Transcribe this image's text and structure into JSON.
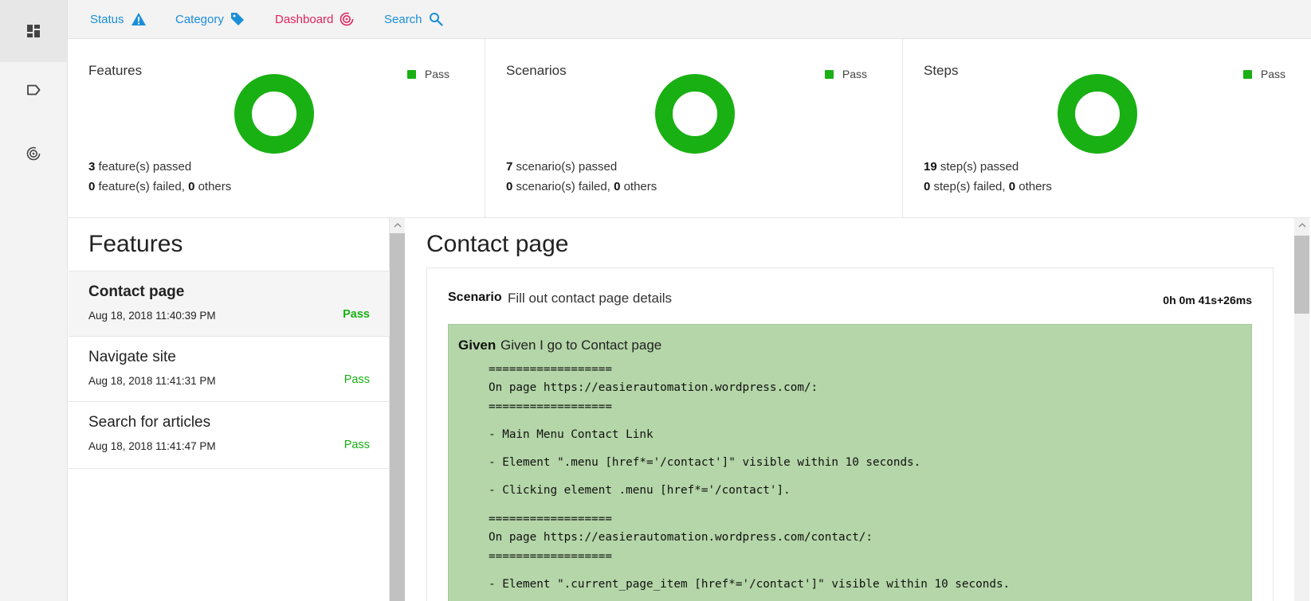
{
  "sidebar": {
    "items": [
      {
        "icon": "dashboard-grid-icon",
        "active": true
      },
      {
        "icon": "tag-outline-icon",
        "active": false
      },
      {
        "icon": "target-icon",
        "active": false
      }
    ]
  },
  "topnav": {
    "status_label": "Status",
    "category_label": "Category",
    "dashboard_label": "Dashboard",
    "search_label": "Search",
    "colors": {
      "status": "#1a8fd8",
      "category": "#1a8fd8",
      "dashboard": "#e0245e",
      "search": "#1a8fd8"
    }
  },
  "cards": {
    "features": {
      "title": "Features",
      "legend": "Pass",
      "passed_count": "3",
      "passed_text": " feature(s) passed",
      "failed_count": "0",
      "failed_text": " feature(s) failed, ",
      "others_count": "0",
      "others_text": " others",
      "pass_fraction": 1.0
    },
    "scenarios": {
      "title": "Scenarios",
      "legend": "Pass",
      "passed_count": "7",
      "passed_text": " scenario(s) passed",
      "failed_count": "0",
      "failed_text": " scenario(s) failed, ",
      "others_count": "0",
      "others_text": " others",
      "pass_fraction": 1.0
    },
    "steps": {
      "title": "Steps",
      "legend": "Pass",
      "passed_count": "19",
      "passed_text": " step(s) passed",
      "failed_count": "0",
      "failed_text": " step(s) failed, ",
      "others_count": "0",
      "others_text": " others",
      "pass_fraction": 1.0
    },
    "pass_color": "#19b013"
  },
  "features_panel": {
    "heading": "Features",
    "items": [
      {
        "name": "Contact page",
        "date": "Aug 18, 2018 11:40:39 PM",
        "status": "Pass"
      },
      {
        "name": "Navigate site",
        "date": "Aug 18, 2018 11:41:31 PM",
        "status": "Pass"
      },
      {
        "name": "Search for articles",
        "date": "Aug 18, 2018 11:41:47 PM",
        "status": "Pass"
      }
    ]
  },
  "detail": {
    "heading": "Contact page",
    "scenario_label": "Scenario",
    "scenario_name": "Fill out contact page details",
    "duration": "0h 0m 41s+26ms",
    "step": {
      "keyword": "Given",
      "text": "Given I go to Contact page",
      "log_lines": [
        "==================",
        "On page https://easierautomation.wordpress.com/:",
        "==================",
        "- Main Menu Contact Link",
        "- Element \".menu [href*='/contact']\" visible within 10 seconds.",
        "- Clicking element .menu [href*='/contact'].",
        "==================",
        "On page https://easierautomation.wordpress.com/contact/:",
        "==================",
        "- Element \".current_page_item [href*='/contact']\" visible within 10 seconds."
      ]
    },
    "step_color": "#b4d6a8"
  }
}
